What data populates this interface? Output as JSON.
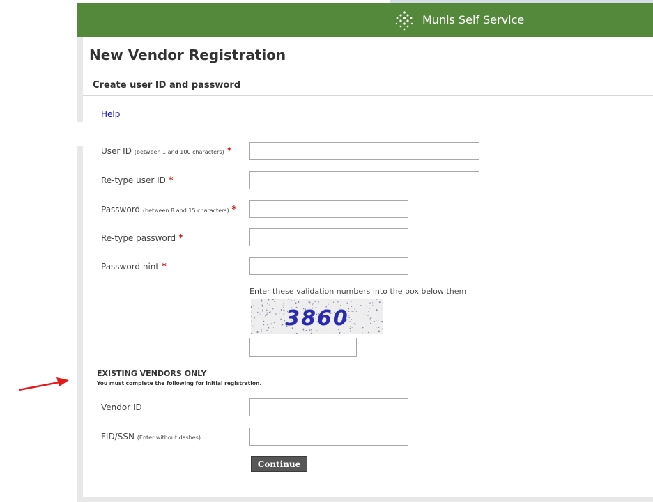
{
  "header": {
    "app_name": "Munis Self Service",
    "logo_icon": "diamond-dots-icon",
    "color": "#54893c"
  },
  "page": {
    "title": "New Vendor Registration",
    "section_title": "Create user ID and password",
    "help_link": "Help"
  },
  "form": {
    "user_id": {
      "label": "User ID",
      "hint": "(between 1 and 100 characters)",
      "value": ""
    },
    "retype_user_id": {
      "label": "Re-type user ID",
      "value": ""
    },
    "password": {
      "label": "Password",
      "hint": "(between 8 and 15 characters)",
      "value": ""
    },
    "retype_password": {
      "label": "Re-type password",
      "value": ""
    },
    "password_hint": {
      "label": "Password hint",
      "value": ""
    },
    "required_marker": "*",
    "required_color": "#d41b1b"
  },
  "captcha": {
    "instruction": "Enter these validation numbers into the box below them",
    "code": "3860",
    "value": ""
  },
  "existing_vendors": {
    "title": "EXISTING VENDORS ONLY",
    "note": "You must complete the following for initial registration.",
    "vendor_id": {
      "label": "Vendor ID",
      "value": ""
    },
    "fid_ssn": {
      "label": "FID/SSN",
      "hint": "(Enter without dashes)",
      "value": ""
    }
  },
  "actions": {
    "continue_label": "Continue"
  },
  "annotation": {
    "arrow_color": "#e31b1b"
  }
}
